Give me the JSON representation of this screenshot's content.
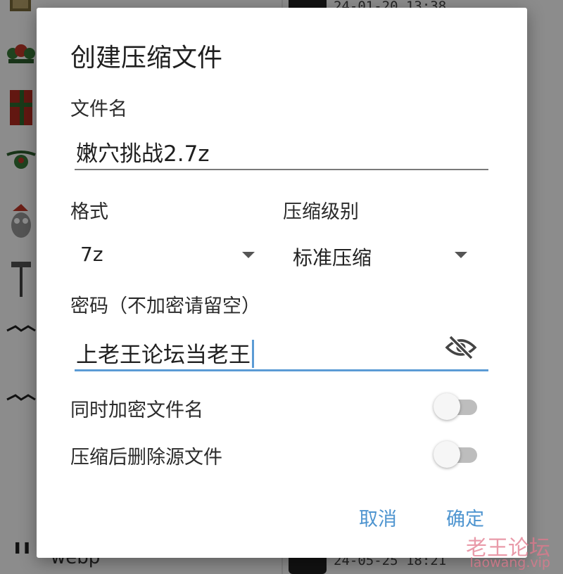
{
  "background": {
    "timestamps": [
      "24-01-20 13:38",
      "24-05-25 18:21"
    ],
    "partial_filename": "webp"
  },
  "dialog": {
    "title": "创建压缩文件",
    "filename_label": "文件名",
    "filename_value": "嫩穴挑战2.7z",
    "format_label": "格式",
    "format_value": "7z",
    "level_label": "压缩级别",
    "level_value": "标准压缩",
    "password_label": "密码（不加密请留空）",
    "password_value": "上老王论坛当老王",
    "encrypt_names_label": "同时加密文件名",
    "encrypt_names_on": false,
    "delete_source_label": "压缩后删除源文件",
    "delete_source_on": false,
    "cancel_label": "取消",
    "confirm_label": "确定"
  },
  "watermark": {
    "title": "老王论坛",
    "url": "laowang.vip"
  },
  "colors": {
    "accent": "#5b9bd5",
    "button_text": "#4f95d0",
    "switch_track_off": "#bdbdbd"
  },
  "icons": [
    "visibility-off-icon",
    "dropdown-arrow-icon"
  ]
}
